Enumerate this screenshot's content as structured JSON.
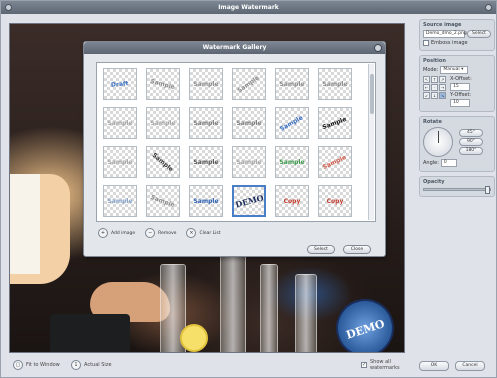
{
  "app": {
    "title": "Image Watermark"
  },
  "canvas": {
    "watermark_text": "DEMO"
  },
  "bottom": {
    "fit_label": "Fit to Window",
    "actual_label": "Actual Size",
    "show_all_label": "Show all watermarks"
  },
  "panel": {
    "source_title": "Source image",
    "source_file": "Demo_dmo_2.png",
    "select_label": "Select",
    "emboss_label": "Emboss image",
    "position_title": "Position",
    "mode_label": "Mode:",
    "mode_value": "Manual",
    "xoffset_label": "X-Offset:",
    "xoffset_value": "15",
    "yoffset_label": "Y-Offset:",
    "yoffset_value": "10",
    "rotate_title": "Rotate",
    "angle_label": "Angle:",
    "angle_value": "0",
    "opacity_title": "Opacity",
    "opacity_value": 100,
    "ok_label": "OK",
    "cancel_label": "Cancel"
  },
  "dialog": {
    "title": "Watermark Gallery",
    "add_label": "Add image",
    "remove_label": "Remove",
    "clear_label": "Clear List",
    "select_label": "Select",
    "close_label": "Close",
    "items": [
      {
        "text": "Draft",
        "color": "#3a6fc4",
        "rot": -5
      },
      {
        "text": "Sample",
        "color": "#8d8d8d",
        "rot": 15
      },
      {
        "text": "Sample",
        "color": "#8d8d8d",
        "rot": 0
      },
      {
        "text": "Sample",
        "color": "#8d8d8d",
        "rot": -35
      },
      {
        "text": "Sample",
        "color": "#8d8d8d",
        "rot": 0
      },
      {
        "text": "Sample",
        "color": "#8d8d8d",
        "rot": 0
      },
      {
        "text": "Sample",
        "color": "#a7a7a7",
        "rot": 0
      },
      {
        "text": "Sample",
        "color": "#a7a7a7",
        "rot": 0
      },
      {
        "text": "Sample",
        "color": "#7c7c7c",
        "rot": 0
      },
      {
        "text": "Sample",
        "color": "#7c7c7c",
        "rot": 0
      },
      {
        "text": "Sample",
        "color": "#3a6fc4",
        "rot": -30
      },
      {
        "text": "Sample",
        "color": "#111111",
        "rot": -20
      },
      {
        "text": "Sample",
        "color": "#a7a7a7",
        "rot": 0
      },
      {
        "text": "Sample",
        "color": "#333333",
        "rot": 40
      },
      {
        "text": "Sample",
        "color": "#555555",
        "rot": 0
      },
      {
        "text": "Sample",
        "color": "#a7a7a7",
        "rot": 0
      },
      {
        "text": "Sample",
        "color": "#3c9a4a",
        "rot": 0
      },
      {
        "text": "Sample",
        "color": "#d05a4a",
        "rot": -25
      },
      {
        "text": "Sample",
        "color": "#8aa5c9",
        "rot": 0
      },
      {
        "text": "Sample",
        "color": "#8d8d8d",
        "rot": 20
      },
      {
        "text": "Sample",
        "color": "#2a5fb0",
        "rot": 0
      },
      {
        "text": "DEMO",
        "color": "#1a2d5a",
        "rot": -15
      },
      {
        "text": "Copy",
        "color": "#c0392b",
        "rot": 0
      },
      {
        "text": "Copy",
        "color": "#c0392b",
        "rot": 0
      }
    ]
  }
}
